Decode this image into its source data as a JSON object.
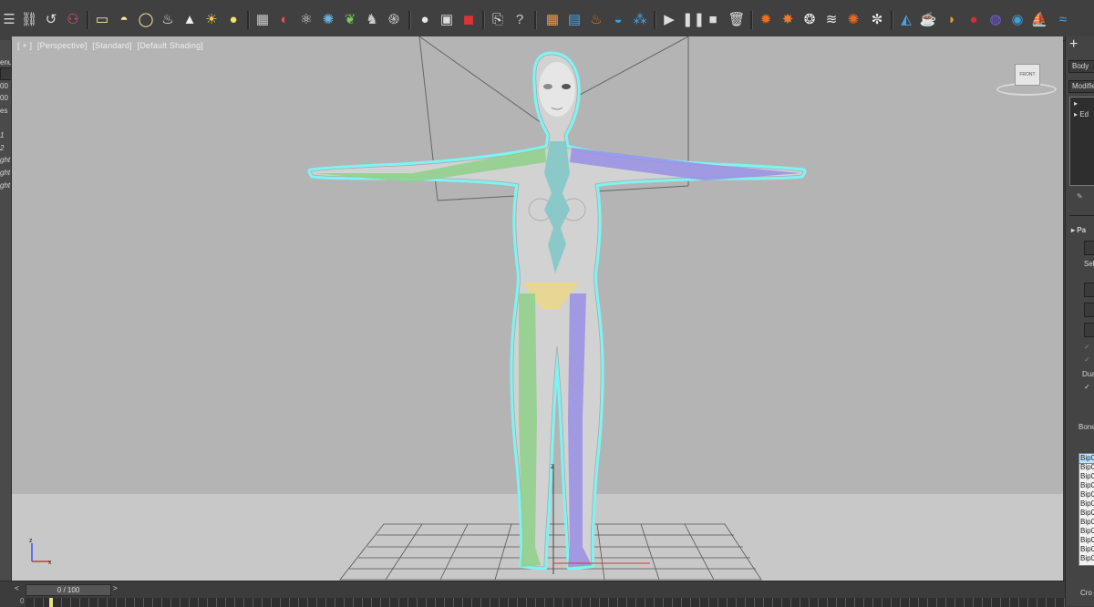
{
  "viewport": {
    "labels": [
      "[ + ]",
      "[Perspective]",
      "[Standard]",
      "[Default Shading]"
    ],
    "viewcube_face": "FRONT",
    "gizmo_axis_z": "z",
    "gizmo_axis_x": "x",
    "transform_axis_z": "z"
  },
  "left_strip": {
    "items": [
      "enu",
      "00",
      "00",
      "es",
      "1",
      "2",
      "ght",
      "ght",
      "ght"
    ]
  },
  "right_panel": {
    "plus": "+",
    "body_field": "Body",
    "modifier_field": "Modifie",
    "stack_items": [
      "▸",
      "▸ Ed"
    ],
    "rollout_title": "▸ Pa",
    "sel_label": "Sel",
    "dual_label": "Dua",
    "bone_label": "Bone",
    "bones": [
      "Bip0",
      "Bip0",
      "Bip0",
      "Bip0",
      "Bip0",
      "Bip0",
      "Bip0",
      "Bip0",
      "Bip0",
      "Bip0",
      "Bip0",
      "Bip0"
    ],
    "bottom_label": "Cro"
  },
  "timeline": {
    "frame": "0 / 100",
    "prev": "<",
    "next": ">",
    "start": "0"
  },
  "colors": {
    "viewport_bg": "#b5b5b5",
    "body": "#d2d2d2",
    "outline": "#7ff3f3",
    "bone_left": "#8fd18b",
    "bone_right": "#9a8fe6",
    "spine": "#7fc8c8",
    "pelvis": "#e8d690"
  }
}
